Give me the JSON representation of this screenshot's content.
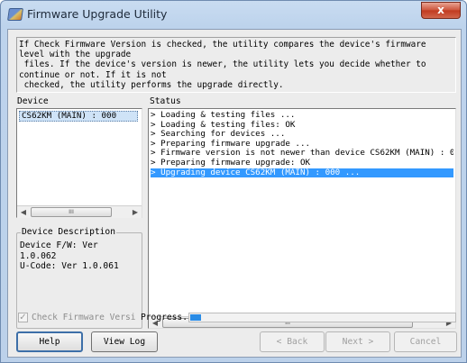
{
  "window": {
    "title": "Firmware Upgrade Utility",
    "close_symbol": "x"
  },
  "description": {
    "text": "If Check Firmware Version is checked, the utility compares the device's firmware\nlevel with the upgrade\n files. If the device's version is newer, the utility lets you decide whether to\ncontinue or not. If it is not\n checked, the utility performs the upgrade directly."
  },
  "device_panel": {
    "header": "Device",
    "items": [
      "CS62KM (MAIN) : 000"
    ],
    "scroll_thumb": "III"
  },
  "device_description": {
    "title": "Device Description",
    "text": "Device F/W: Ver\n1.0.062\nU-Code: Ver 1.0.061"
  },
  "status_panel": {
    "header": "Status",
    "lines": [
      {
        "text": "> Loading & testing files ...",
        "selected": false
      },
      {
        "text": "> Loading & testing files: OK",
        "selected": false
      },
      {
        "text": "> Searching for devices ...",
        "selected": false
      },
      {
        "text": "> Preparing firmware upgrade ...",
        "selected": false
      },
      {
        "text": "> Firmware version is not newer than device CS62KM (MAIN) : 00",
        "selected": false
      },
      {
        "text": "> Preparing firmware upgrade: OK",
        "selected": false
      },
      {
        "text": "> Upgrading device CS62KM (MAIN) : 000 ...",
        "selected": true
      }
    ],
    "scroll_thumb": "III"
  },
  "check_firmware": {
    "label": "Check Firmware Versi",
    "checked": true
  },
  "progress": {
    "label": "Progress.",
    "value_fraction": 0.04
  },
  "buttons": {
    "help": "Help",
    "view_log": "View Log",
    "back": "< Back",
    "next": "Next >",
    "cancel": "Cancel"
  },
  "colors": {
    "selection": "#3399ff",
    "progress": "#2a8ce6"
  }
}
